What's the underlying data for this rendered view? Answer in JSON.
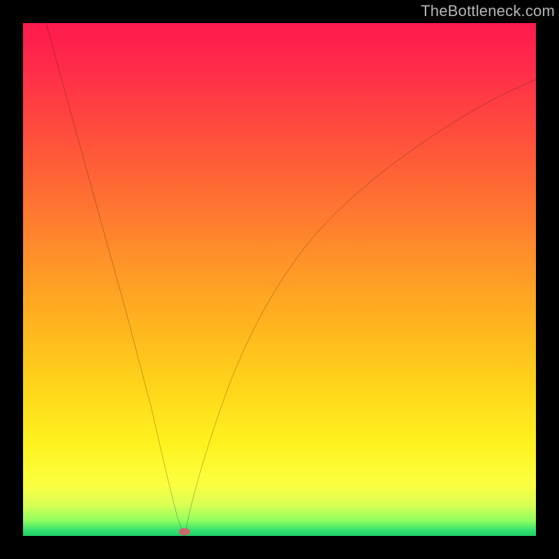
{
  "watermark": {
    "text": "TheBottleneck.com"
  },
  "chart_data": {
    "type": "line",
    "title": "",
    "xlabel": "",
    "ylabel": "",
    "xlim": [
      0,
      100
    ],
    "ylim": [
      0,
      100
    ],
    "grid": false,
    "legend": false,
    "background_gradient": {
      "direction": "vertical",
      "stops": [
        {
          "pos": 0.0,
          "color": "#ff1a4d"
        },
        {
          "pos": 0.45,
          "color": "#ff8f2a"
        },
        {
          "pos": 0.82,
          "color": "#fff21f"
        },
        {
          "pos": 1.0,
          "color": "#1ecf66"
        }
      ]
    },
    "series": [
      {
        "name": "bottleneck-curve",
        "color": "#000000",
        "x": [
          4.5,
          10,
          15,
          20,
          25,
          28,
          30,
          31,
          31.5,
          32,
          33,
          35,
          38,
          42,
          47,
          53,
          60,
          68,
          77,
          87,
          100
        ],
        "values": [
          100,
          80,
          62,
          44,
          25,
          12,
          4,
          1,
          0,
          1,
          4,
          11,
          21,
          32,
          43,
          53,
          62,
          70,
          77,
          83,
          89
        ]
      }
    ],
    "annotations": [
      {
        "name": "min-marker",
        "x": 31.5,
        "y": 0,
        "shape": "rounded-dot",
        "color": "#c96969"
      }
    ]
  }
}
